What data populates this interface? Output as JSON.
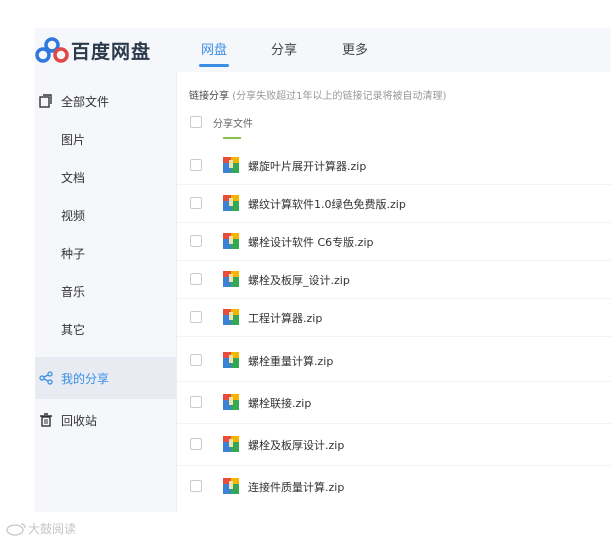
{
  "header": {
    "logo_text": "百度网盘",
    "tabs": [
      {
        "label": "网盘",
        "active": true
      },
      {
        "label": "分享",
        "active": false
      },
      {
        "label": "更多",
        "active": false
      }
    ]
  },
  "sidebar": {
    "items": [
      {
        "label": "全部文件",
        "icon": "folder-icon"
      },
      {
        "label": "图片"
      },
      {
        "label": "文档"
      },
      {
        "label": "视频"
      },
      {
        "label": "种子"
      },
      {
        "label": "音乐"
      },
      {
        "label": "其它"
      },
      {
        "label": "我的分享",
        "icon": "share-icon",
        "active": true
      },
      {
        "label": "回收站",
        "icon": "trash-icon"
      }
    ]
  },
  "main": {
    "breadcrumb_title": "链接分享",
    "breadcrumb_note": "(分享失败超过1年以上的链接记录将被自动清理)",
    "column_header": "分享文件",
    "files": [
      {
        "name": "螺旋叶片展开计算器.zip"
      },
      {
        "name": "螺纹计算软件1.0绿色免费版.zip"
      },
      {
        "name": "螺栓设计软件 C6专版.zip"
      },
      {
        "name": "螺栓及板厚_设计.zip"
      },
      {
        "name": "工程计算器.zip"
      },
      {
        "name": "螺栓重量计算.zip"
      },
      {
        "name": "螺栓联接.zip"
      },
      {
        "name": "螺栓及板厚设计.zip"
      },
      {
        "name": "连接件质量计算.zip"
      }
    ]
  },
  "watermark": "大鼓阅读",
  "colors": {
    "accent": "#3a8ee6",
    "active_bg": "#e8ecf2"
  }
}
